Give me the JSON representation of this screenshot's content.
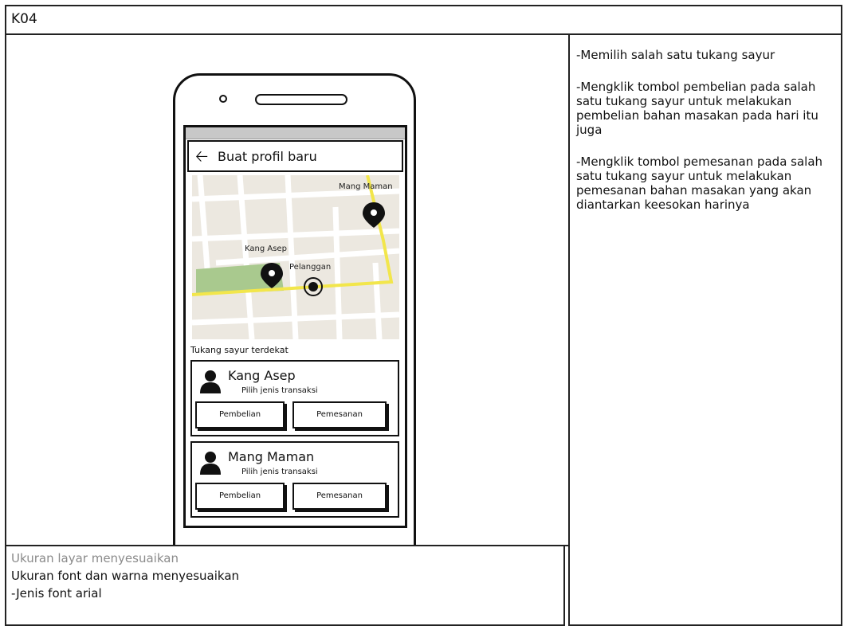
{
  "header": {
    "title": "K04"
  },
  "phone": {
    "title": "Buat profil baru",
    "back_icon": "arrow-left-icon",
    "map": {
      "labels": {
        "vendor_a": "Kang Asep",
        "vendor_b": "Mang Maman",
        "customer": "Pelanggan"
      },
      "colors": {
        "road_highlight": "#f2e64b",
        "park": "#a9c98e",
        "background": "#ece8e0"
      }
    },
    "section_label": "Tukang sayur terdekat",
    "vendors": [
      {
        "name": "Kang Asep",
        "subtitle": "Pilih jenis transaksi",
        "buy_label": "Pembelian",
        "order_label": "Pemesanan"
      },
      {
        "name": "Mang Maman",
        "subtitle": "Pilih jenis transaksi",
        "buy_label": "Pembelian",
        "order_label": "Pemesanan"
      }
    ]
  },
  "notes": [
    "-Memilih salah satu tukang sayur",
    "-Mengklik tombol pembelian pada salah satu tukang sayur untuk melakukan pembelian bahan masakan pada hari itu juga",
    "-Mengklik tombol pemesanan pada salah satu tukang sayur untuk melakukan pemesanan bahan masakan yang akan diantarkan keesokan harinya"
  ],
  "footer_notes": {
    "line1": "Ukuran layar menyesuaikan",
    "line2": "Ukuran font dan warna menyesuaikan",
    "line3": "-Jenis font arial"
  }
}
